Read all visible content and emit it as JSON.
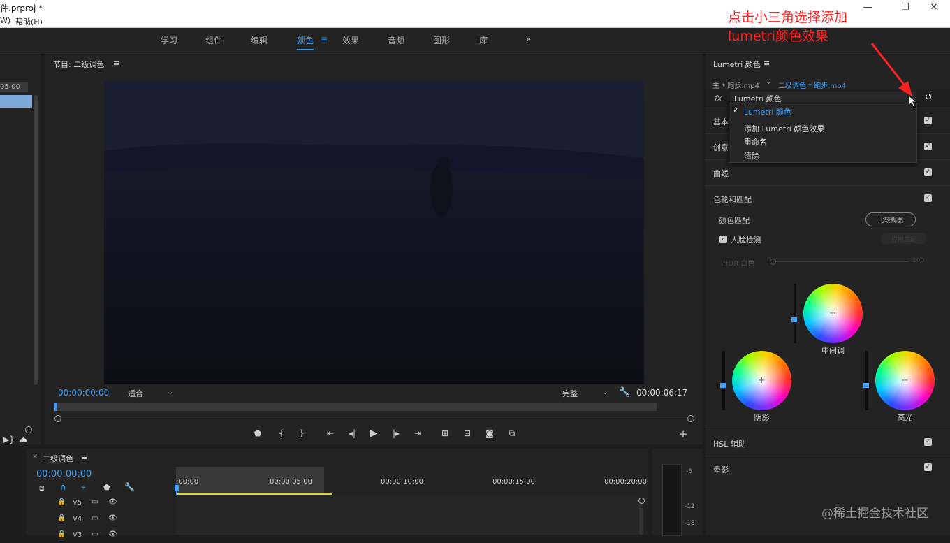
{
  "window": {
    "title": "件.prproj *",
    "menu": [
      "W)",
      "帮助(H)"
    ]
  },
  "workspaces": [
    "学习",
    "组件",
    "编辑",
    "颜色",
    "效果",
    "音频",
    "图形",
    "库",
    "»"
  ],
  "active_workspace": "颜色",
  "left_panel": {
    "timecode": "05:00"
  },
  "program": {
    "title": "节目: 二级调色",
    "menu_icon": "≡",
    "timecode_current": "00:00:00:00",
    "fit": "适合",
    "quality": "完整",
    "timecode_duration": "00:00:06:17"
  },
  "transport": [
    "marker-icon",
    "in-point-icon",
    "out-point-icon",
    "go-to-in-icon",
    "step-back-icon",
    "play-icon",
    "step-forward-icon",
    "go-to-out-icon",
    "lift-icon",
    "extract-icon",
    "export-frame-icon",
    "compare-icon",
    "add-icon"
  ],
  "lumetri": {
    "title": "Lumetri 颜色",
    "menu_icon": "≡",
    "source": "主 * 跑步.mp4",
    "clip": "二级调色 * 跑步.mp4",
    "fx_label": "fx",
    "effect_select": "Lumetri 颜色",
    "dropdown": {
      "checked_item": "Lumetri 颜色",
      "items": [
        "添加 Lumetri 颜色效果",
        "重命名",
        "清除"
      ]
    },
    "sections": [
      "基本",
      "创意",
      "曲线",
      "色轮和匹配",
      "HSL 辅助",
      "晕影"
    ],
    "color_match": "颜色匹配",
    "compare_view": "比较视图",
    "face_detect": "人脸检测",
    "apply_match": "应用匹配",
    "hdr_white": "HDR 白色",
    "hdr_max": "100",
    "wheels": [
      {
        "name": "中间调",
        "slider_level": 0.4
      },
      {
        "name": "阴影",
        "slider_level": 0.5
      },
      {
        "name": "高光",
        "slider_level": 0.5
      }
    ]
  },
  "timeline": {
    "title": "二级调色",
    "timecode": "00:00:00:00",
    "ruler": [
      ":00:00",
      "00:00:05:00",
      "00:00:10:00",
      "00:00:15:00",
      "00:00:20:00"
    ],
    "tracks": [
      "V5",
      "V4",
      "V3"
    ]
  },
  "meter": {
    "ticks": [
      "-6",
      "-12",
      "-18"
    ]
  },
  "annotation": {
    "line1": "点击小三角选择添加",
    "line2": "lumetri颜色效果"
  },
  "watermark": "@稀土掘金技术社区",
  "colors": {
    "accent": "#3d9cf5",
    "annotation": "#ff2222",
    "panel": "#232323"
  }
}
